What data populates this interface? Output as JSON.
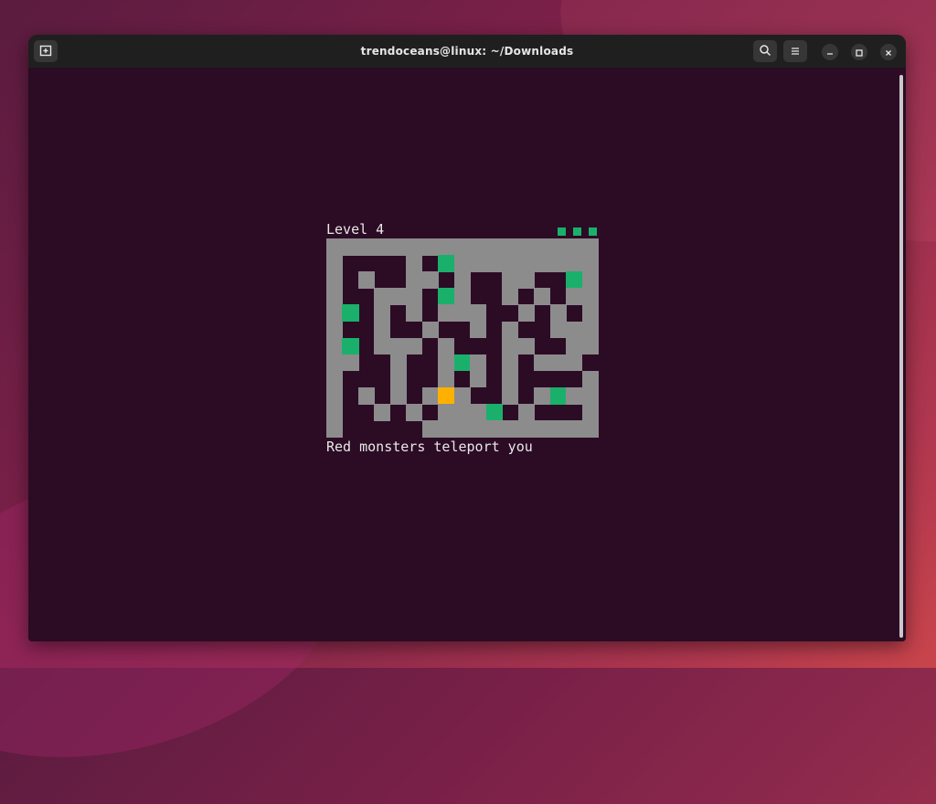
{
  "window": {
    "title": "trendoceans@linux: ~/Downloads"
  },
  "titlebar_icons": {
    "new_tab": "new-tab-icon",
    "search": "search-icon",
    "menu": "hamburger-menu-icon",
    "minimize": "minimize-icon",
    "maximize": "maximize-icon",
    "close": "close-icon"
  },
  "game": {
    "level_label": "Level 4",
    "lives": 3,
    "message": "Red monsters teleport you",
    "colors": {
      "background": "#2c0b24",
      "wall": "#8c8c8c",
      "gem": "#1ab06b",
      "player": "#ffb000"
    },
    "legend": {
      "#": "wall",
      ".": "floor",
      "G": "green gem",
      "P": "player"
    },
    "grid": [
      "#################",
      "#....#.G#########",
      "#.#..##.#..##..G#",
      "#..###.G#..#.#.##",
      "#G.#.#.###..#.#.#",
      "#..#..#..#.#..###",
      "#G.###.#...##..##",
      "##..#..#G#.#.###.#",
      "#...#..#.#.#....#",
      "#.#.#.#P#..#.#G##",
      "#..#.#.###G.#...#",
      "#.....###########"
    ]
  }
}
